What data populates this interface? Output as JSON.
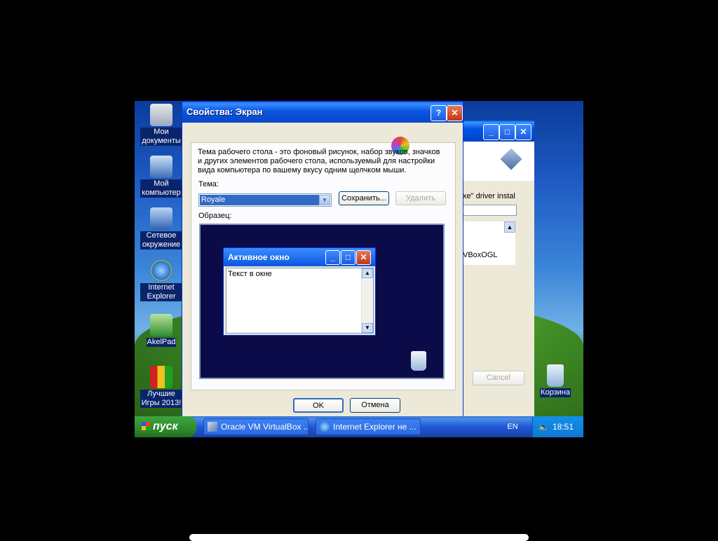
{
  "desktop_icons": [
    {
      "label": "Мои документы",
      "icon": "my-documents-icon"
    },
    {
      "label": "Мой компьютер",
      "icon": "my-computer-icon"
    },
    {
      "label": "Сетевое окружение",
      "icon": "network-icon"
    },
    {
      "label": "Internet Explorer",
      "icon": "internet-explorer-icon"
    },
    {
      "label": "AkelPad",
      "icon": "akelpad-icon"
    },
    {
      "label": "Лучшие Игры 2013!",
      "icon": "games-icon"
    },
    {
      "label": "Корзина",
      "icon": "recycle-bin-icon"
    }
  ],
  "background_window": {
    "text_fragment1": "xe\" driver instal",
    "text_fragment2": "VBoxOGL",
    "cancel_label": "Cancel"
  },
  "dialog": {
    "title": "Свойства: Экран",
    "help_label": "?",
    "close_label": "✕",
    "description": "Тема рабочего стола - это фоновый рисунок, набор звуков, значков и других элементов рабочего стола, используемый для настройки вида компьютера по вашему вкусу одним щелчком мыши.",
    "theme_label": "Тема:",
    "theme_value": "Royale",
    "save_label": "Сохранить...",
    "delete_label": "Удалить",
    "sample_label": "Образец:",
    "preview_window_title": "Активное окно",
    "preview_window_text": "Текст в окне",
    "ok_label": "OK",
    "cancel_label": "Отмена"
  },
  "taskbar": {
    "start_label": "пуск",
    "tasks": [
      {
        "label": "Oracle VM VirtualBox ..."
      },
      {
        "label": "Internet Explorer не ..."
      }
    ],
    "language": "EN",
    "clock": "18:51"
  }
}
